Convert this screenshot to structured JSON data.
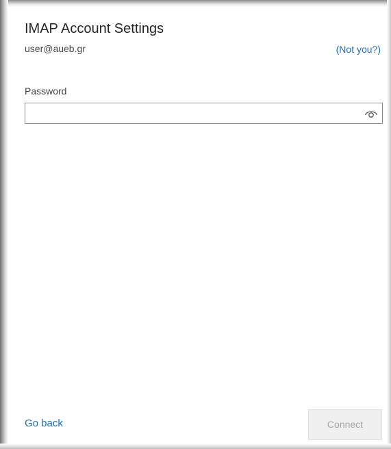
{
  "dialog": {
    "title": "IMAP Account Settings",
    "email": "user@aueb.gr",
    "not_you_link": "(Not you?)"
  },
  "password": {
    "label": "Password",
    "value": "",
    "show_icon": "eye-icon"
  },
  "footer": {
    "go_back_label": "Go back",
    "connect_label": "Connect",
    "connect_enabled": false
  },
  "colors": {
    "link": "#1d6fb8",
    "disabled_button_bg": "#f0f0f0",
    "disabled_button_text": "#a6a6a6"
  }
}
